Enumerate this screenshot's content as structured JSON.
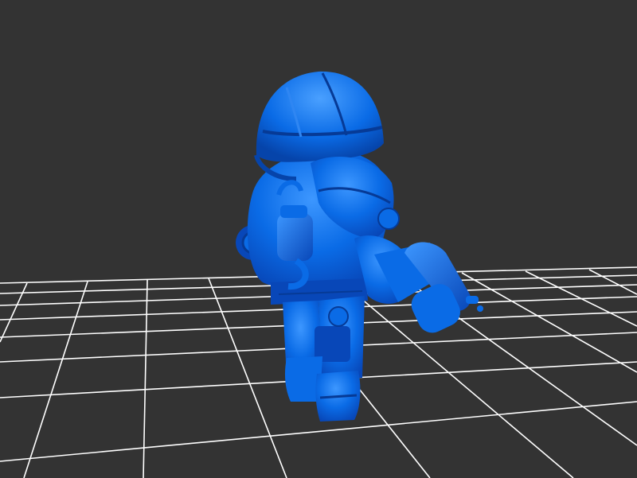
{
  "viewport": {
    "background_color": "#333333",
    "grid_color": "#ffffff",
    "model_color": "#0a6be6",
    "model_shadow_color": "#0847b8",
    "model_highlight_color": "#3d97ff"
  },
  "model": {
    "subject": "armored-diver-figure-icon"
  }
}
